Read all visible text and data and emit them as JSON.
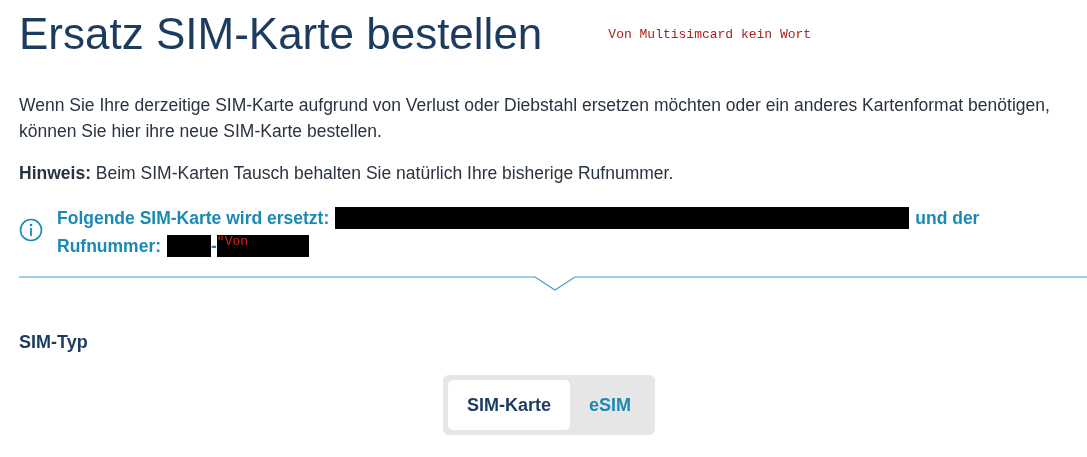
{
  "title": "Ersatz SIM-Karte bestellen",
  "annotation": "Von Multisimcard kein Wort",
  "intro": "Wenn Sie Ihre derzeitige SIM-Karte aufgrund von Verlust oder Diebstahl ersetzen möchten oder ein anderes Kartenformat benötigen, können Sie hier ihre neue SIM-Karte bestellen.",
  "hint": "**Hinweis:** Beim SIM-Karten Tausch behalten Sie natürlich Ihre bisherige Rufnummer.",
  "info": {
    "lead": "Folgende SIM-Karte wird ersetzt:",
    "middle": "und der",
    "number_label": "Rufnummer:",
    "separator": "-",
    "overlay_note": "\"Von"
  },
  "section_label": "SIM-Typ",
  "sim_types": [
    {
      "label": "SIM-Karte",
      "selected": true
    },
    {
      "label": "eSIM",
      "selected": false
    }
  ]
}
